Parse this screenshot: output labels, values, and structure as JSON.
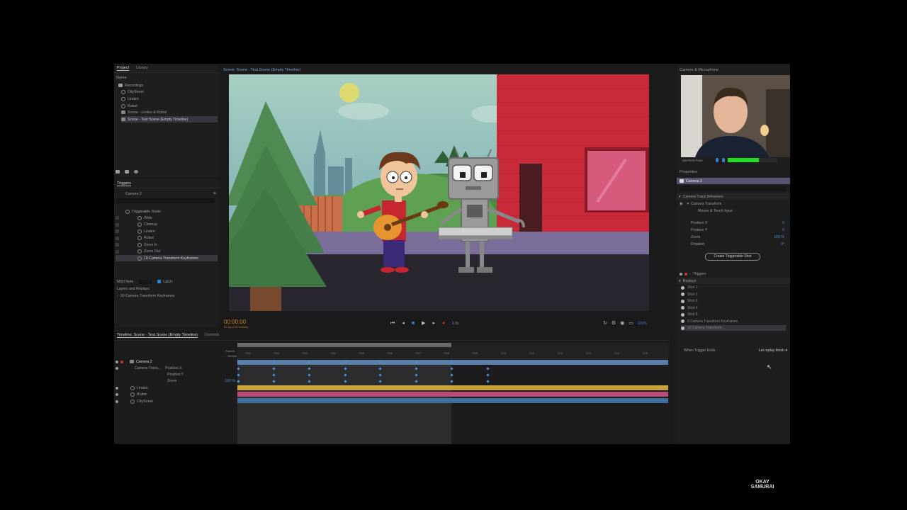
{
  "app": {
    "project_panel": {
      "tabs": [
        "Project",
        "Library"
      ],
      "name_header": "Name",
      "items": [
        {
          "label": "Recordings",
          "type": "folder"
        },
        {
          "label": "CityStreet",
          "type": "puppet"
        },
        {
          "label": "Linden",
          "type": "puppet"
        },
        {
          "label": "Robot",
          "type": "puppet"
        },
        {
          "label": "Scene - Linden & Robot",
          "type": "scene"
        },
        {
          "label": "Scene - Test Scene (Empty Timeline)",
          "type": "scene",
          "selected": true
        }
      ]
    },
    "triggers_panel": {
      "tab": "Triggers",
      "selected": "Camera 2",
      "add_icon": "+",
      "group": "Triggerable Shots",
      "items": [
        "Wide",
        "Closeup",
        "Linden",
        "Robot",
        "Zoom In",
        "Zoom Out",
        "10 Camera Transform Keyframes"
      ],
      "midi_label": "MIDI Note",
      "latch_label": "Latch",
      "latch_checked": true,
      "layers_label": "Layers and Replays",
      "layers_item": "10 Camera Transform Keyframes"
    },
    "scene_panel": {
      "title": "Scene: Scene - Test Scene (Empty Timeline)"
    },
    "transport": {
      "timecode": "00:00:00",
      "fps_note": "31 fps (2x1 frames)",
      "speed": "1.0x",
      "zoom": "120%"
    },
    "timeline": {
      "tabs": [
        "Timeline: Scene - Test Scene (Empty Timeline)",
        "Controls"
      ],
      "ruler_labels": [
        "Frames",
        "Hh:Mm:Ss"
      ],
      "tracks": [
        {
          "label": "Camera 2",
          "color": "#5b7fa8"
        },
        {
          "label": "Camera Trans... ",
          "color": ""
        },
        {
          "label": "Position X",
          "value": "",
          "color": ""
        },
        {
          "label": "Position Y",
          "value": "",
          "color": ""
        },
        {
          "label": "Zoom",
          "value": "100 %",
          "color": ""
        },
        {
          "label": "Linden",
          "color": "#c9a23a"
        },
        {
          "label": "Robot",
          "color": "#b84d7a"
        },
        {
          "label": "CityStreet",
          "color": "#3e6e9e"
        }
      ],
      "tick_labels": [
        "0:01",
        "0:02",
        "0:03",
        "0:04",
        "0:05",
        "0:06",
        "0:07",
        "0:08",
        "0:09",
        "0:10",
        "0:11",
        "0:12",
        "0:13",
        "0:14",
        "0:15"
      ]
    },
    "camera_panel": {
      "title": "Camera & Microphone",
      "set_rest_pose": "Set Rest Pose",
      "level_color": "#22dd22"
    },
    "properties_panel": {
      "title": "Properties",
      "camera": "Camera 2",
      "section": "Camera Track Behaviors",
      "behavior": "Camera Transform",
      "handle": "Mouse & Touch Input",
      "params": [
        {
          "label": "Position X",
          "value": "0"
        },
        {
          "label": "Position Y",
          "value": "0"
        },
        {
          "label": "Zoom",
          "value": "100 %"
        },
        {
          "label": "Rotation",
          "value": "0°"
        }
      ],
      "create_btn": "Create Triggerable Shot",
      "triggers_label": "Triggers",
      "replays_label": "Replays",
      "replays": [
        "Shot 1",
        "Shot 2",
        "Shot 3",
        "Shot 4",
        "Shot 5",
        "6 Camera Transform Keyframes",
        "10 Camera Transform..."
      ],
      "when_label": "When Trigger Ends",
      "when_value": "Let replay finish"
    }
  },
  "watermark": {
    "line1": "OKAY",
    "line2": "SAMURAI"
  }
}
